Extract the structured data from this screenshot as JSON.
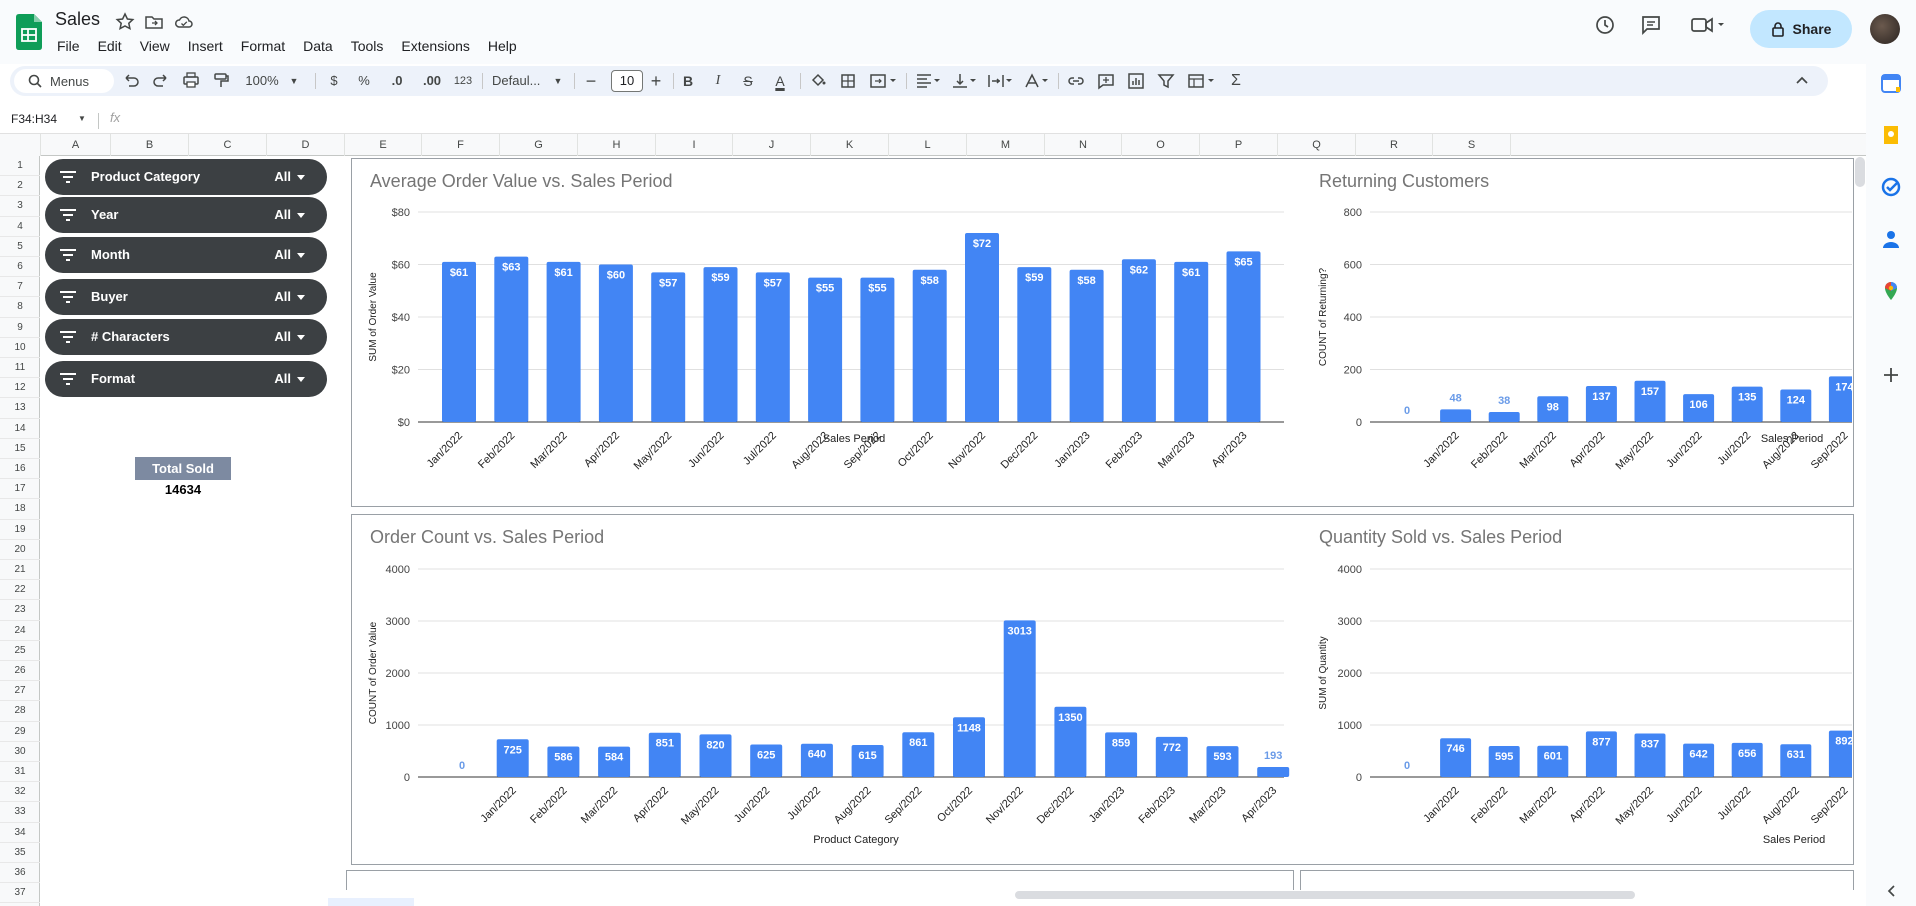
{
  "app": {
    "doc_title": "Sales",
    "menu": [
      "File",
      "Edit",
      "View",
      "Insert",
      "Format",
      "Data",
      "Tools",
      "Extensions",
      "Help"
    ],
    "share_label": "Share"
  },
  "toolbar": {
    "menus_label": "Menus",
    "zoom": "100%",
    "currency": "$",
    "percent": "%",
    "dec_decrease": ".0",
    "dec_increase": ".00",
    "number_format": "123",
    "font": "Defaul...",
    "font_size": "10",
    "minus": "−",
    "plus": "+",
    "bold": "B",
    "italic": "I",
    "strike": "S",
    "text_color": "A",
    "sigma": "Σ"
  },
  "formula_bar": {
    "name_box": "F34:H34",
    "fx": "fx"
  },
  "columns": [
    "A",
    "B",
    "C",
    "D",
    "E",
    "F",
    "G",
    "H",
    "I",
    "J",
    "K",
    "L",
    "M",
    "N",
    "O",
    "P",
    "Q",
    "R",
    "S"
  ],
  "rows": [
    "1",
    "2",
    "3",
    "4",
    "5",
    "6",
    "7",
    "8",
    "9",
    "10",
    "11",
    "12",
    "13",
    "14",
    "15",
    "16",
    "17",
    "18",
    "19",
    "20",
    "21",
    "22",
    "23",
    "24",
    "25",
    "26",
    "27",
    "28",
    "29",
    "30",
    "31",
    "32",
    "33",
    "34",
    "35",
    "36",
    "37"
  ],
  "slicers": [
    {
      "label": "Product Category",
      "value": "All"
    },
    {
      "label": "Year",
      "value": "All"
    },
    {
      "label": "Month",
      "value": "All"
    },
    {
      "label": "Buyer",
      "value": "All"
    },
    {
      "label": "# Characters",
      "value": "All"
    },
    {
      "label": "Format",
      "value": "All"
    }
  ],
  "summary": {
    "total_sold_label": "Total Sold",
    "total_sold_value": "14634"
  },
  "colors": {
    "bar": "#4285f4",
    "slicer_bg": "#3c4043",
    "share_bg": "#c2e7ff",
    "total_header": "#7d8aa1"
  },
  "chart_data": [
    {
      "type": "bar",
      "title": "Average Order Value vs. Sales Period",
      "xlabel": "Sales Period",
      "ylabel": "SUM of Order Value",
      "ylim": [
        0,
        80
      ],
      "yticks": [
        "$0",
        "$20",
        "$40",
        "$60",
        "$80"
      ],
      "grid": true,
      "categories": [
        "Jan/2022",
        "Feb/2022",
        "Mar/2022",
        "Apr/2022",
        "May/2022",
        "Jun/2022",
        "Jul/2022",
        "Aug/2022",
        "Sep/2022",
        "Oct/2022",
        "Nov/2022",
        "Dec/2022",
        "Jan/2023",
        "Feb/2023",
        "Mar/2023",
        "Apr/2023"
      ],
      "values": [
        61,
        63,
        61,
        60,
        57,
        59,
        57,
        55,
        55,
        58,
        72,
        59,
        58,
        62,
        61,
        65
      ],
      "value_labels": [
        "$61",
        "$63",
        "$61",
        "$60",
        "$57",
        "$59",
        "$57",
        "$55",
        "$55",
        "$58",
        "$72",
        "$59",
        "$58",
        "$62",
        "$61",
        "$65"
      ]
    },
    {
      "type": "bar",
      "title": "Returning Customers",
      "xlabel": "Sales Period",
      "ylabel": "COUNT of Returning?",
      "ylim": [
        0,
        800
      ],
      "yticks": [
        "0",
        "200",
        "400",
        "600",
        "800"
      ],
      "grid": true,
      "categories": [
        "",
        "Jan/2022",
        "Feb/2022",
        "Mar/2022",
        "Apr/2022",
        "May/2022",
        "Jun/2022",
        "Jul/2022",
        "Aug/2022",
        "Sep/2022"
      ],
      "values": [
        0,
        48,
        38,
        98,
        137,
        157,
        106,
        135,
        124,
        174
      ],
      "value_labels": [
        "0",
        "48",
        "38",
        "98",
        "137",
        "157",
        "106",
        "135",
        "124",
        "174"
      ]
    },
    {
      "type": "bar",
      "title": "Order Count vs. Sales Period",
      "xlabel": "Product Category",
      "ylabel": "COUNT of Order Value",
      "ylim": [
        0,
        4000
      ],
      "yticks": [
        "0",
        "1000",
        "2000",
        "3000",
        "4000"
      ],
      "grid": true,
      "categories": [
        "",
        "Jan/2022",
        "Feb/2022",
        "Mar/2022",
        "Apr/2022",
        "May/2022",
        "Jun/2022",
        "Jul/2022",
        "Aug/2022",
        "Sep/2022",
        "Oct/2022",
        "Nov/2022",
        "Dec/2022",
        "Jan/2023",
        "Feb/2023",
        "Mar/2023",
        "Apr/2023"
      ],
      "values": [
        0,
        725,
        586,
        584,
        851,
        820,
        625,
        640,
        615,
        861,
        1148,
        3013,
        1350,
        859,
        772,
        593,
        193
      ],
      "value_labels": [
        "0",
        "725",
        "586",
        "584",
        "851",
        "820",
        "625",
        "640",
        "615",
        "861",
        "1148",
        "3013",
        "1350",
        "859",
        "772",
        "593",
        "193"
      ]
    },
    {
      "type": "bar",
      "title": "Quantity Sold vs. Sales Period",
      "xlabel": "Sales Period",
      "ylabel": "SUM of Quantity",
      "ylim": [
        0,
        4000
      ],
      "yticks": [
        "0",
        "1000",
        "2000",
        "3000",
        "4000"
      ],
      "grid": true,
      "categories": [
        "",
        "Jan/2022",
        "Feb/2022",
        "Mar/2022",
        "Apr/2022",
        "May/2022",
        "Jun/2022",
        "Jul/2022",
        "Aug/2022",
        "Sep/2022"
      ],
      "values": [
        0,
        746,
        595,
        601,
        877,
        837,
        642,
        656,
        631,
        892
      ],
      "value_labels": [
        "0",
        "746",
        "595",
        "601",
        "877",
        "837",
        "642",
        "656",
        "631",
        "892"
      ]
    }
  ]
}
